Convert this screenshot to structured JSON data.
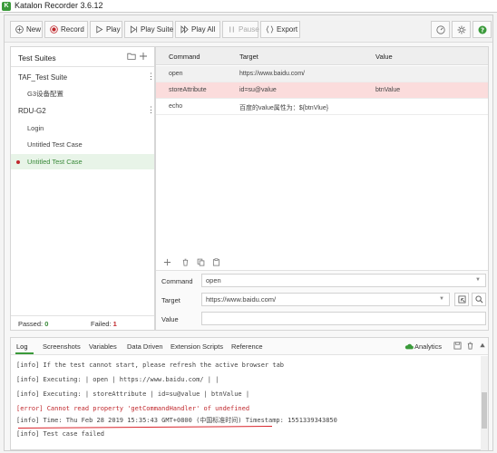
{
  "window": {
    "title": "Katalon Recorder 3.6.12"
  },
  "toolbar": {
    "new": "New",
    "record": "Record",
    "play": "Play",
    "play_suite": "Play Suite",
    "play_all": "Play All",
    "pause": "Pause",
    "export": "Export"
  },
  "left": {
    "title": "Test Suites",
    "suites": [
      {
        "name": "TAF_Test Suite",
        "cases": [
          "G3设备配置"
        ]
      },
      {
        "name": "RDU-G2",
        "cases": [
          "Login",
          "Untitled Test Case",
          "Untitled Test Case"
        ]
      }
    ],
    "passed_label": "Passed:",
    "passed_value": "0",
    "failed_label": "Failed:",
    "failed_value": "1"
  },
  "table": {
    "headers": {
      "command": "Command",
      "target": "Target",
      "value": "Value"
    },
    "rows": [
      {
        "command": "open",
        "target": "https://www.baidu.com/",
        "value": ""
      },
      {
        "command": "storeAttribute",
        "target": "id=su@value",
        "value": "btnValue"
      },
      {
        "command": "echo",
        "target": "百度的value属性为：${btnVlue}",
        "value": ""
      }
    ]
  },
  "form": {
    "command_label": "Command",
    "command_value": "open",
    "target_label": "Target",
    "target_value": "https://www.baidu.com/",
    "value_label": "Value",
    "value_value": ""
  },
  "log": {
    "tabs": [
      "Log",
      "Screenshots",
      "Variables",
      "Data Driven",
      "Extension Scripts",
      "Reference"
    ],
    "analytics": "Analytics",
    "lines": [
      "[info] If the test cannot start, please refresh the active browser tab",
      "[info] Executing: | open | https://www.baidu.com/ | |",
      "[info] Executing: | storeAttribute | id=su@value | btnValue |",
      "[error] Cannot read property 'getCommandHandler' of undefined",
      "[info] Time: Thu Feb 28 2019 15:35:43 GMT+0800 (中国标准时间) Timestamp: 1551339343850",
      "[info] Test case failed"
    ]
  },
  "colors": {
    "accent_green": "#3a9a3a",
    "record_red": "#c0282d",
    "selected_row": "#fbdcdc",
    "error_text": "#c0282d"
  }
}
